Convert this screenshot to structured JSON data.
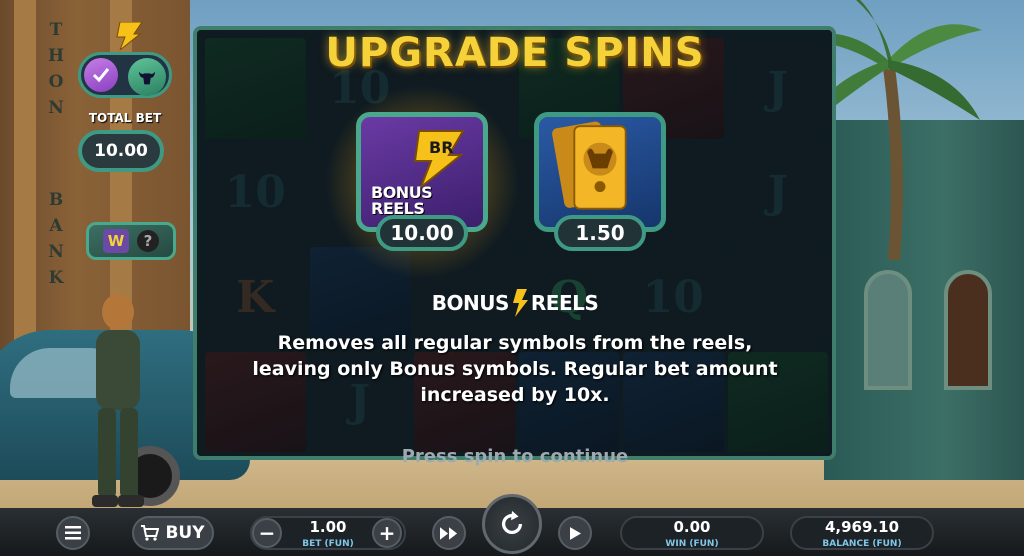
{
  "modal": {
    "title": "UPGRADE SPINS",
    "options": [
      {
        "label": "BONUS REELS",
        "value": "10.00",
        "selected": true
      },
      {
        "label": "",
        "value": "1.50",
        "selected": false
      }
    ],
    "logo_text_left": "BONUS",
    "logo_text_right": "REELS",
    "description": "Removes all regular symbols from the reels, leaving only Bonus symbols. Regular bet amount increased by 10x.",
    "prompt": "Press spin to continue"
  },
  "side_panel": {
    "total_bet_label": "TOTAL BET",
    "total_bet_value": "10.00"
  },
  "background": {
    "bank_letters": [
      "T",
      "H",
      "O",
      "N",
      "",
      "B",
      "A",
      "N",
      "K"
    ]
  },
  "reels": [
    [
      "",
      "10",
      "",
      "",
      "",
      "J"
    ],
    [
      "10",
      "",
      "",
      "",
      "",
      "J"
    ],
    [
      "K",
      "",
      "",
      "Q",
      "10",
      ""
    ],
    [
      "",
      "J",
      "",
      "",
      "",
      ""
    ]
  ],
  "bottom_bar": {
    "buy_label": "BUY",
    "bet_value": "1.00",
    "bet_label": "BET (FUN)",
    "win_value": "0.00",
    "win_label": "WIN (FUN)",
    "balance_value": "4,969.10",
    "balance_label": "BALANCE (FUN)"
  },
  "colors": {
    "title_gold": "#f6d23a",
    "frame_green": "#3f9a84",
    "label_blue": "#7fc6e8"
  }
}
